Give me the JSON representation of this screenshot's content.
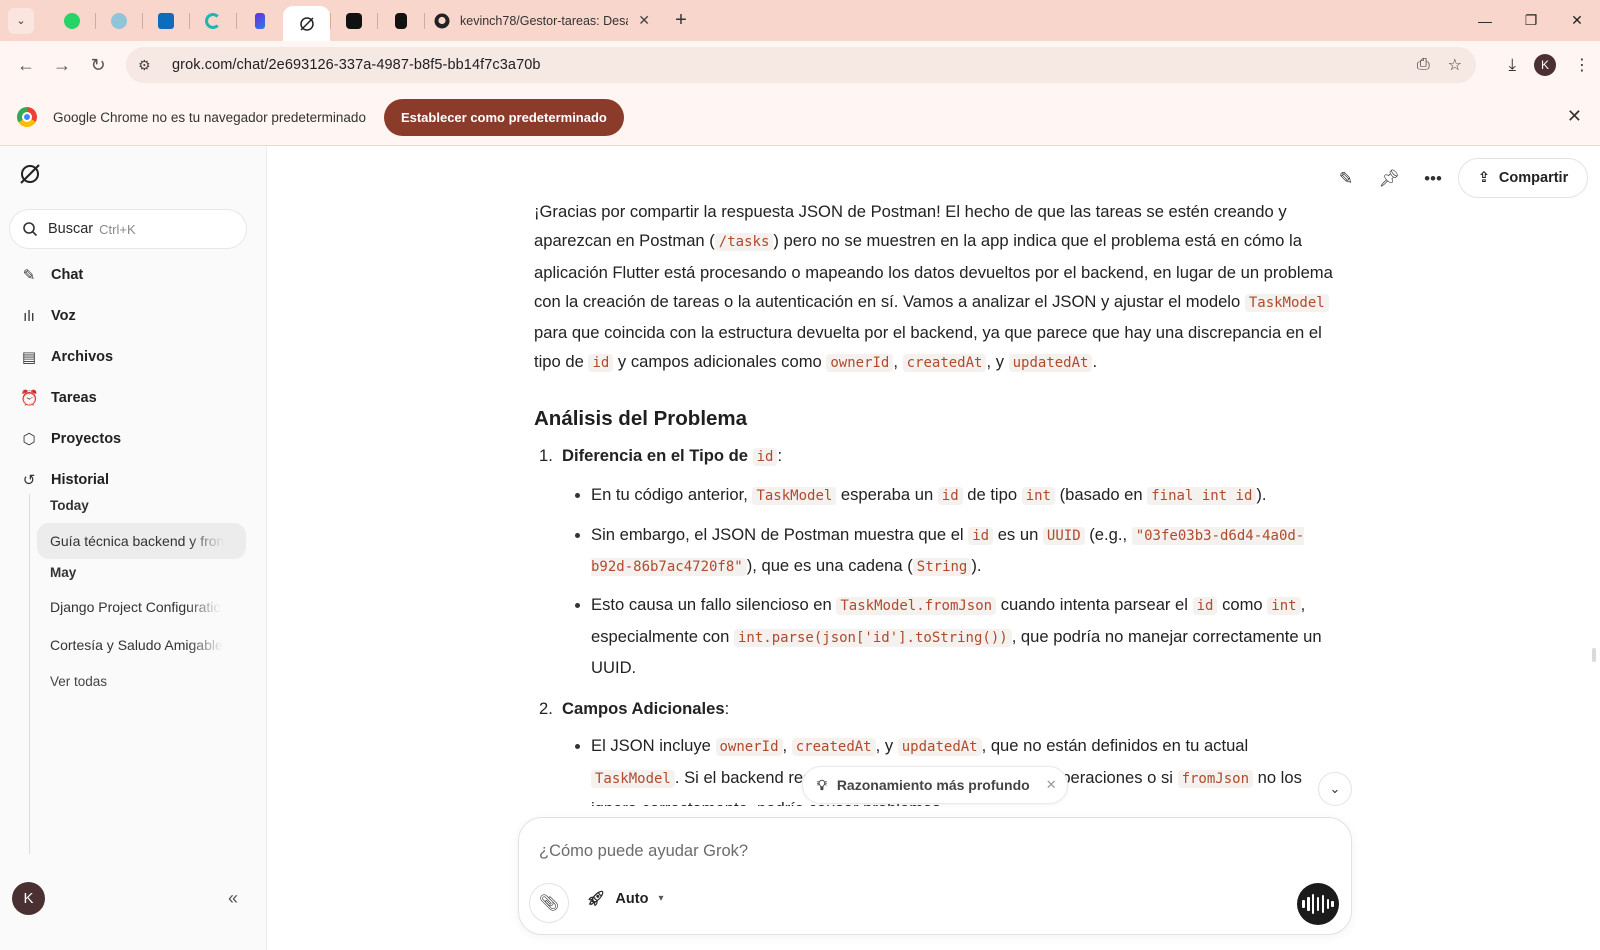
{
  "browser": {
    "active_tab_title": "kevinch78/Gestor-tareas: Desar",
    "url": "grok.com/chat/2e693126-337a-4987-b8f5-bb14f7c3a70b",
    "profile_initial": "K",
    "pinned_tab_icons": [
      "whatsapp-icon",
      "globe-icon",
      "outlook-icon",
      "c-app-icon",
      "p-app-icon",
      "grok-icon",
      "app-icon",
      "app-icon"
    ]
  },
  "infobar": {
    "text": "Google Chrome no es tu navegador predeterminado",
    "button": "Establecer como predeterminado"
  },
  "sidebar": {
    "search_label": "Buscar",
    "search_shortcut": "Ctrl+K",
    "nav": [
      {
        "label": "Chat",
        "icon": "edit-icon"
      },
      {
        "label": "Voz",
        "icon": "waveform-icon"
      },
      {
        "label": "Archivos",
        "icon": "file-icon"
      },
      {
        "label": "Tareas",
        "icon": "alarm-icon"
      },
      {
        "label": "Proyectos",
        "icon": "box-icon"
      },
      {
        "label": "Historial",
        "icon": "history-icon"
      }
    ],
    "history": {
      "today_label": "Today",
      "today_items": [
        "Guía técnica backend y fron"
      ],
      "may_label": "May",
      "may_items": [
        "Django Project Configuratio",
        "Cortesía y Saludo Amigable"
      ],
      "see_all": "Ver todas"
    },
    "user_initial": "K"
  },
  "header": {
    "share_label": "Compartir"
  },
  "message": {
    "p1": [
      "¡Gracias por compartir la respuesta JSON de Postman! El hecho de que las tareas se estén creando y aparezcan en Postman (",
      "/tasks",
      ") pero no se muestren en la app indica que el problema está en cómo la aplicación Flutter está procesando o mapeando los datos devueltos por el backend, en lugar de un problema con la creación de tareas o la autenticación en sí. Vamos a analizar el JSON y ajustar el modelo ",
      "TaskModel",
      " para que coincida con la estructura devuelta por el backend, ya que parece que hay una discrepancia en el tipo de ",
      "id",
      " y campos adicionales como ",
      "ownerId",
      ", ",
      "createdAt",
      ", y ",
      "updatedAt",
      "."
    ],
    "heading": "Análisis del Problema",
    "item1": {
      "num": "1.",
      "title": "Diferencia en el Tipo de",
      "title_code": "id",
      "title_suffix": ":",
      "b1": [
        "En tu código anterior, ",
        "TaskModel",
        " esperaba un ",
        "id",
        " de tipo ",
        "int",
        " (basado en ",
        "final int id",
        ")."
      ],
      "b2": [
        "Sin embargo, el JSON de Postman muestra que el ",
        "id",
        " es un ",
        "UUID",
        " (e.g., ",
        "\"03fe03b3-d6d4-4a0d-b92d-86b7ac4720f8\"",
        "), que es una cadena (",
        "String",
        ")."
      ],
      "b3": [
        "Esto causa un fallo silencioso en ",
        "TaskModel.fromJson",
        " cuando intenta parsear el ",
        "id",
        " como ",
        "int",
        ", especialmente con ",
        "int.parse(json['id'].toString())",
        ", que podría no manejar correctamente un UUID."
      ]
    },
    "item2": {
      "num": "2.",
      "title": "Campos Adicionales",
      "title_suffix": ":",
      "b1": [
        "El JSON incluye ",
        "ownerId",
        ", ",
        "createdAt",
        ", y ",
        "updatedAt",
        ", que no están definidos en tu actual ",
        "TaskModel",
        ". Si el backend requiere estos campos para ciertas operaciones o si ",
        "fromJson",
        " no los ignora correctamente, podría causar problemas."
      ]
    }
  },
  "reasoning_chip": "Razonamiento más profundo",
  "composer": {
    "placeholder": "¿Cómo puede ayudar Grok?",
    "mode": "Auto"
  }
}
